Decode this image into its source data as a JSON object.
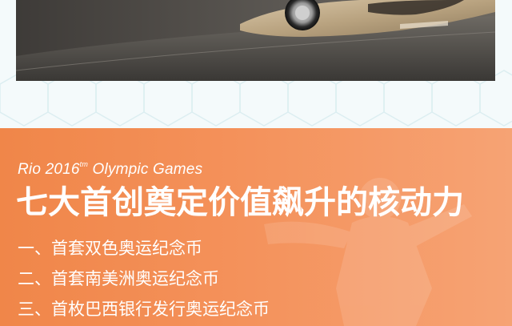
{
  "promo": {
    "subtitle_main": "Rio 2016",
    "subtitle_sup": "tm",
    "subtitle_tail": " Olympic Games",
    "headline": "七大首创奠定价值飙升的核动力",
    "items": [
      "一、首套双色奥运纪念币",
      "二、首套南美洲奥运纪念币",
      "三、首枚巴西银行发行奥运纪念币"
    ]
  },
  "colors": {
    "banner_orange": "#f08649",
    "page_background": "#f4fafb",
    "hex_line": "#dceef1"
  }
}
